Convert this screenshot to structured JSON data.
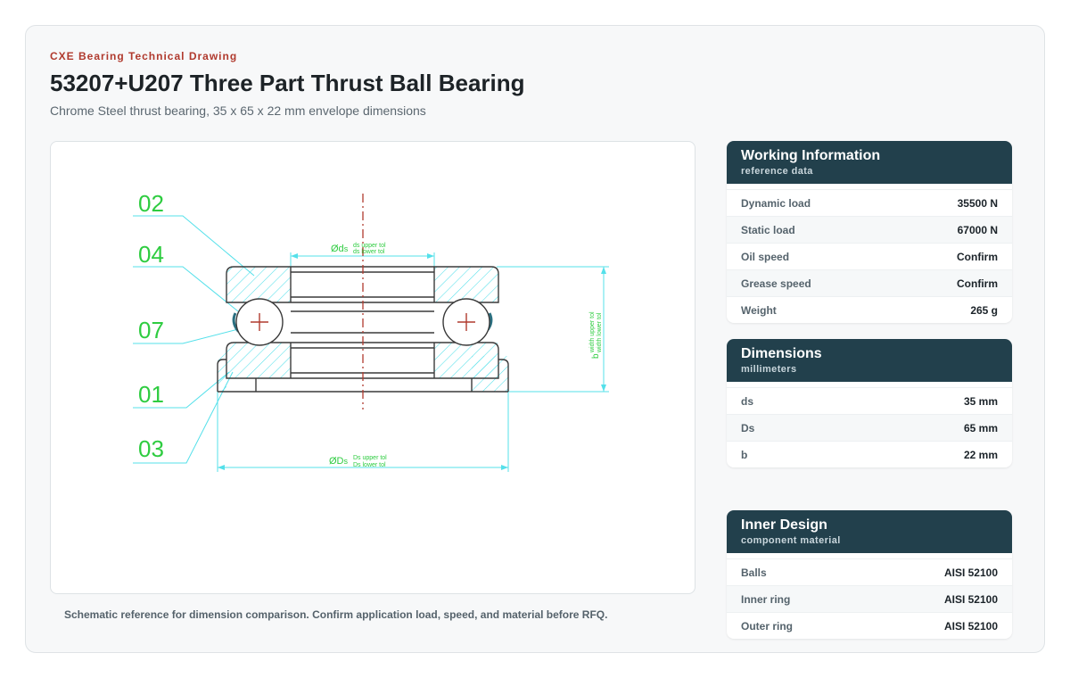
{
  "header": {
    "eyebrow": "CXE Bearing Technical Drawing",
    "title": "53207+U207 Three Part Thrust Ball Bearing",
    "subtitle": "Chrome Steel thrust bearing, 35 x 65 x 22 mm envelope dimensions"
  },
  "drawing": {
    "callouts": [
      "02",
      "04",
      "07",
      "01",
      "03"
    ],
    "ds_symbol": "Ød",
    "ds_sub": "s",
    "ds_upper": "ds upper tol",
    "ds_lower": "ds lower tol",
    "Ds_symbol": "ØD",
    "Ds_sub": "s",
    "Ds_upper": "Ds upper tol",
    "Ds_lower": "Ds lower tol",
    "b_label": "b",
    "b_upper": "width upper tol",
    "b_lower": "width lower tol",
    "colors": {
      "callout": "#2ecc40",
      "leader": "#54e0ea",
      "outline": "#3a3a3a",
      "hatch": "#54e0ea",
      "center": "#b03a2e"
    }
  },
  "caption": "Schematic reference for dimension comparison. Confirm application load, speed, and material before RFQ.",
  "panels": {
    "working": {
      "title": "Working Information",
      "subtitle": "reference data",
      "rows": [
        {
          "label": "Dynamic load",
          "value": "35500 N"
        },
        {
          "label": "Static load",
          "value": "67000 N"
        },
        {
          "label": "Oil speed",
          "value": "Confirm"
        },
        {
          "label": "Grease speed",
          "value": "Confirm"
        },
        {
          "label": "Weight",
          "value": "265 g"
        }
      ]
    },
    "dimensions": {
      "title": "Dimensions",
      "subtitle": "millimeters",
      "rows": [
        {
          "label": "ds",
          "value": "35 mm"
        },
        {
          "label": "Ds",
          "value": "65 mm"
        },
        {
          "label": "b",
          "value": "22 mm"
        }
      ]
    },
    "inner": {
      "title": "Inner Design",
      "subtitle": "component material",
      "rows": [
        {
          "label": "Balls",
          "value": "AISI 52100"
        },
        {
          "label": "Inner ring",
          "value": "AISI 52100"
        },
        {
          "label": "Outer ring",
          "value": "AISI 52100"
        }
      ]
    }
  }
}
